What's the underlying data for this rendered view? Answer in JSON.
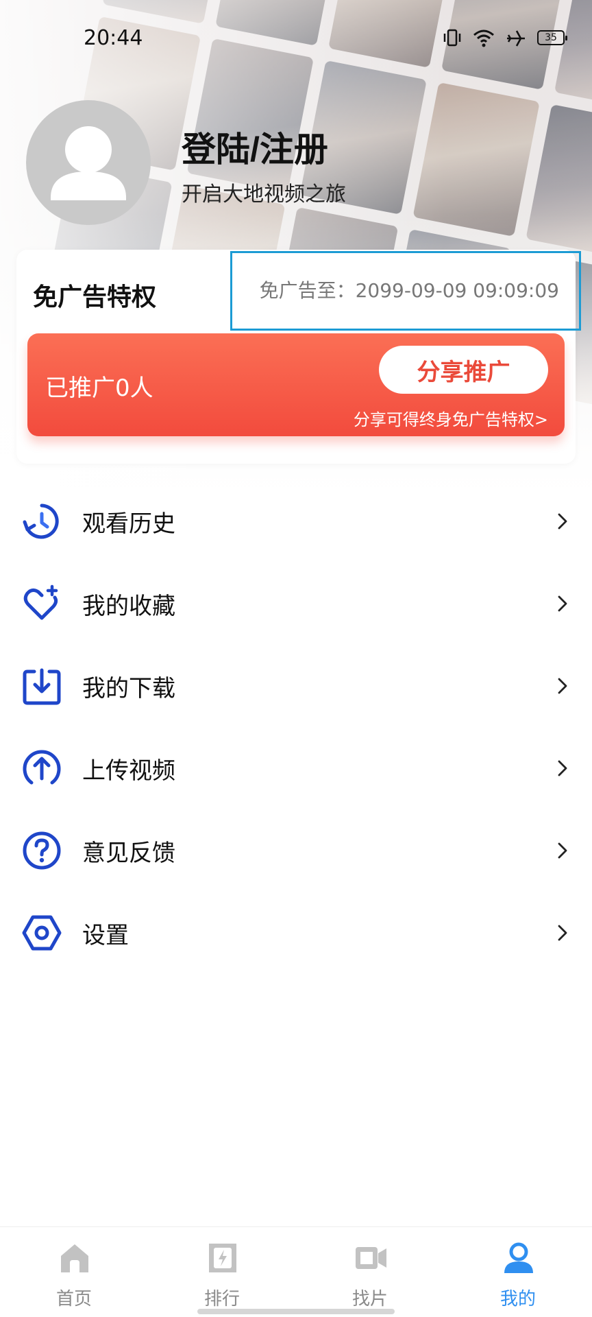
{
  "status_bar": {
    "time": "20:44",
    "battery": "35",
    "icons": [
      "vibrate-icon",
      "wifi-icon",
      "airplane-icon",
      "battery-icon"
    ]
  },
  "profile": {
    "login_title": "登陆/注册",
    "subtitle": "开启大地视频之旅"
  },
  "ad_free": {
    "title": "免广告特权",
    "until": "免广告至：2099-09-09 09:09:09",
    "promoted_count": "已推广0人",
    "share_button": "分享推广",
    "share_note": "分享可得终身免广告特权>"
  },
  "menu": [
    {
      "label": "观看历史",
      "icon": "history-icon"
    },
    {
      "label": "我的收藏",
      "icon": "favorite-heart-icon"
    },
    {
      "label": "我的下载",
      "icon": "download-icon"
    },
    {
      "label": "上传视频",
      "icon": "upload-icon"
    },
    {
      "label": "意见反馈",
      "icon": "help-question-icon"
    },
    {
      "label": "设置",
      "icon": "settings-hexagon-icon"
    }
  ],
  "bottom_nav": [
    {
      "label": "首页",
      "icon": "home-icon",
      "active": false
    },
    {
      "label": "排行",
      "icon": "ranking-icon",
      "active": false
    },
    {
      "label": "找片",
      "icon": "video-camera-icon",
      "active": false
    },
    {
      "label": "我的",
      "icon": "user-icon",
      "active": true
    }
  ],
  "colors": {
    "accent_blue": "#2f8ff0",
    "icon_blue": "#1f46c9",
    "promo_red": "#f24b3d",
    "highlight_border": "#1c9bd4"
  }
}
